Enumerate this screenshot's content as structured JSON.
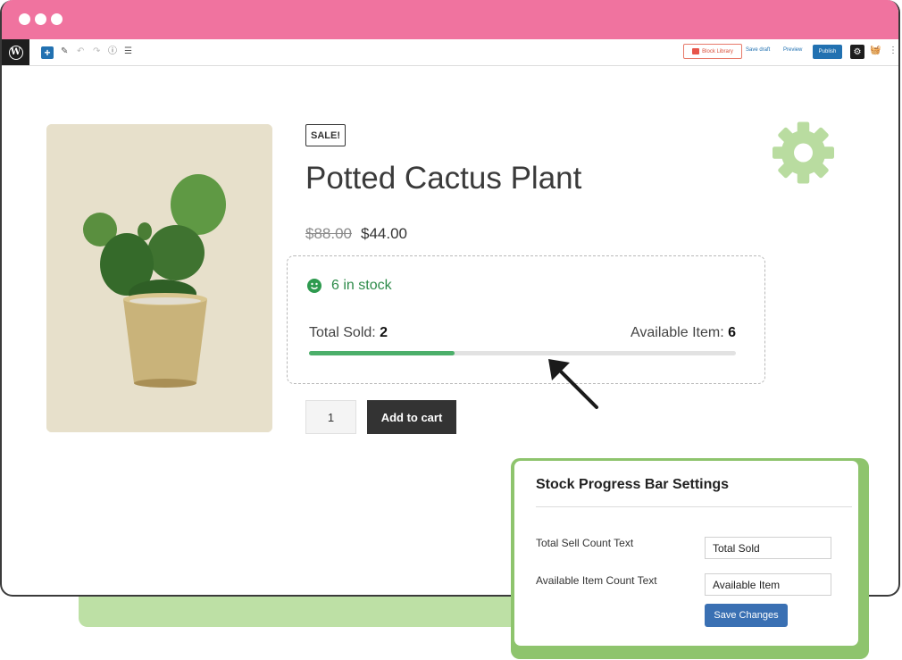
{
  "toolbar": {
    "block_library_label": "Block Library",
    "save_draft_label": "Save draft",
    "preview_label": "Preview",
    "publish_label": "Publish"
  },
  "product": {
    "sale_badge": "SALE!",
    "title": "Potted Cactus Plant",
    "price_regular": "$88.00",
    "price_sale": "$44.00",
    "quantity": "1",
    "add_to_cart_label": "Add to cart"
  },
  "stock": {
    "status_text": "6 in stock",
    "total_sold_label": "Total Sold:",
    "total_sold_value": "2",
    "available_label": "Available Item:",
    "available_value": "6",
    "progress_fraction": 0.34
  },
  "settings_panel": {
    "title": "Stock Progress Bar Settings",
    "rows": [
      {
        "label": "Total Sell Count Text",
        "value": "Total Sold"
      },
      {
        "label": "Available Item Count Text",
        "value": "Available Item"
      }
    ],
    "save_label": "Save Changes"
  },
  "colors": {
    "titlebar": "#f0739f",
    "accent_green": "#8ec46d",
    "progress_green": "#4caf6a",
    "wp_blue": "#2271b1"
  },
  "icons": [
    "wordpress-logo-icon",
    "plus-icon",
    "pencil-icon",
    "undo-icon",
    "redo-icon",
    "info-icon",
    "list-view-icon",
    "settings-gear-icon",
    "basket-icon",
    "more-options-icon",
    "smiley-icon",
    "decorative-gear-icon",
    "pointer-arrow-icon"
  ]
}
